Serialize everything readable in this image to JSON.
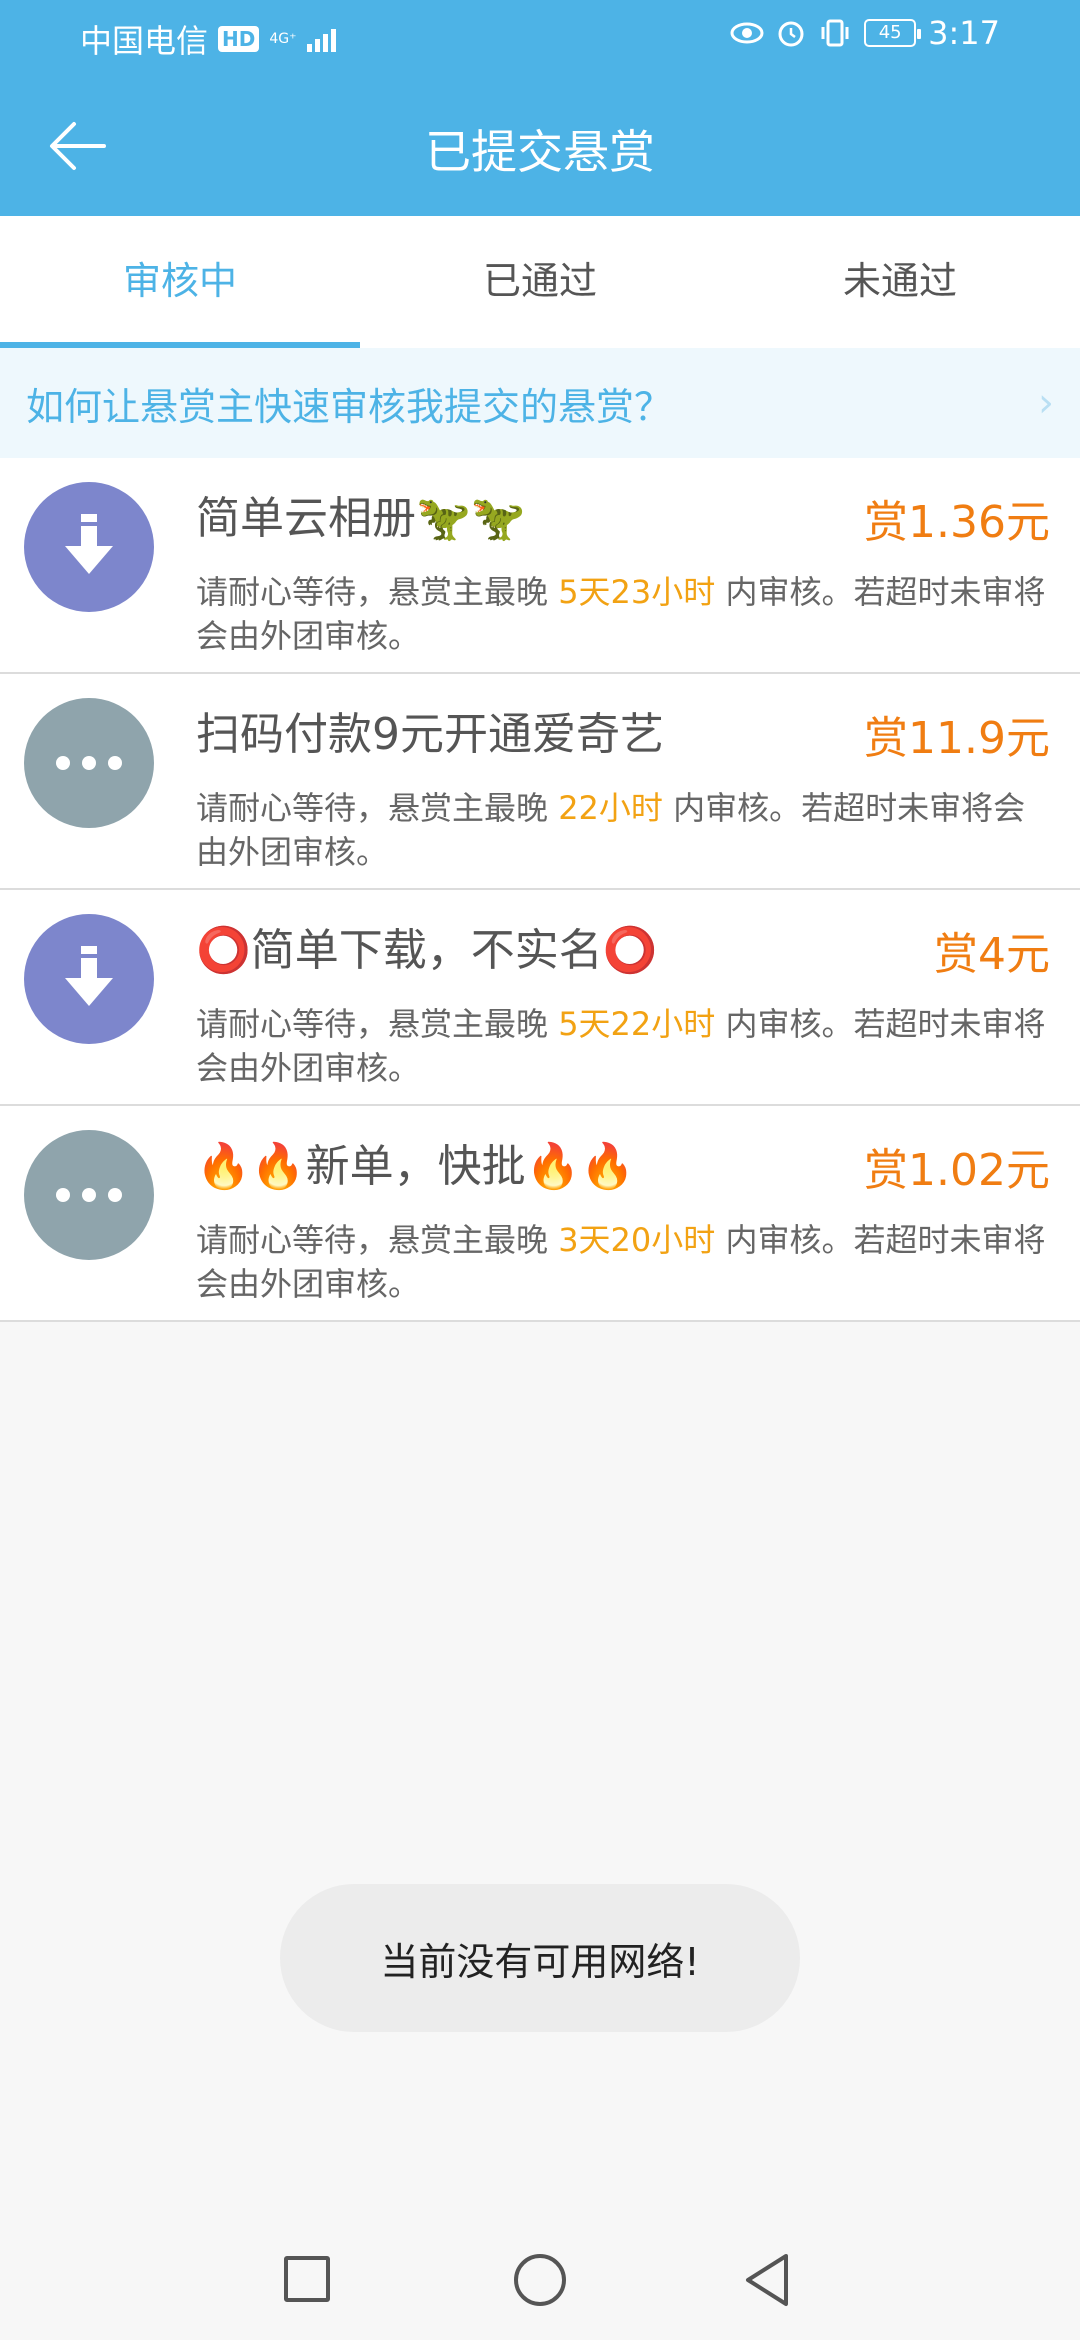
{
  "status_bar": {
    "carrier": "中国电信",
    "hd": "HD",
    "network": "4G⁺",
    "battery": "45",
    "time": "3:17"
  },
  "header": {
    "title": "已提交悬赏",
    "back_icon": "arrow-left-icon"
  },
  "tabs": [
    {
      "label": "审核中",
      "active": true
    },
    {
      "label": "已通过",
      "active": false
    },
    {
      "label": "未通过",
      "active": false
    }
  ],
  "tip": {
    "text": "如何让悬赏主快速审核我提交的悬赏？",
    "chevron": "›"
  },
  "items": [
    {
      "icon": "download-icon",
      "title": "简单云相册🦖🦖",
      "reward": "赏1.36元",
      "desc_before": "请耐心等待，悬赏主最晚 ",
      "desc_time": "5天23小时",
      "desc_after": " 内审核。若超时未审将会由外团审核。"
    },
    {
      "icon": "more-icon",
      "title": "扫码付款9元开通爱奇艺",
      "reward": "赏11.9元",
      "desc_before": "请耐心等待，悬赏主最晚 ",
      "desc_time": "22小时",
      "desc_after": " 内审核。若超时未审将会由外团审核。"
    },
    {
      "icon": "download-icon",
      "title": "⭕简单下载，不实名⭕",
      "reward": "赏4元",
      "desc_before": "请耐心等待，悬赏主最晚 ",
      "desc_time": "5天22小时",
      "desc_after": " 内审核。若超时未审将会由外团审核。"
    },
    {
      "icon": "more-icon",
      "title": "🔥🔥新单，快批🔥🔥",
      "reward": "赏1.02元",
      "desc_before": "请耐心等待，悬赏主最晚 ",
      "desc_time": "3天20小时",
      "desc_after": " 内审核。若超时未审将会由外团审核。"
    }
  ],
  "toast": {
    "text": "当前没有可用网络!"
  },
  "colors": {
    "primary": "#4db3e6",
    "reward": "#f07d12",
    "highlight": "#f2a213"
  }
}
